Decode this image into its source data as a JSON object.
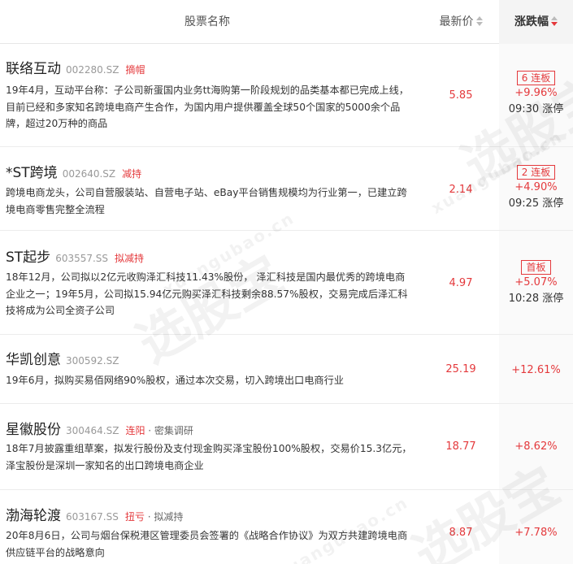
{
  "header": {
    "name_label": "股票名称",
    "price_label": "最新价",
    "change_label": "涨跌幅"
  },
  "rows": [
    {
      "name": "联络互动",
      "code": "002280.SZ",
      "tag": "摘帽",
      "tag2": "",
      "desc": "19年4月，互动平台称：子公司新蛋国内业务tt海购第一阶段规划的品类基本都已完成上线，目前已经和多家知名跨境电商产生合作，为国内用户提供覆盖全球50个国家的5000余个品牌，超过20万种的商品",
      "price": "5.85",
      "board": "6 连板",
      "change": "+9.96%",
      "limit_time": "09:30 涨停"
    },
    {
      "name": "*ST跨境",
      "code": "002640.SZ",
      "tag": "减持",
      "tag2": "",
      "desc": "跨境电商龙头，公司自营服装站、自营电子站、eBay平台销售规模均为行业第一，已建立跨境电商零售完整全流程",
      "price": "2.14",
      "board": "2 连板",
      "change": "+4.90%",
      "limit_time": "09:25 涨停"
    },
    {
      "name": "ST起步",
      "code": "603557.SS",
      "tag": "拟减持",
      "tag2": "",
      "desc": "18年12月，公司拟以2亿元收购泽汇科技11.43%股份， 泽汇科技是国内最优秀的跨境电商企业之一；19年5月，公司拟15.94亿元购买泽汇科技剩余88.57%股权，交易完成后泽汇科技将成为公司全资子公司",
      "price": "4.97",
      "board": "首板",
      "change": "+5.07%",
      "limit_time": "10:28 涨停"
    },
    {
      "name": "华凯创意",
      "code": "300592.SZ",
      "tag": "",
      "tag2": "",
      "desc": "19年6月，拟购买易佰网络90%股权，通过本次交易，切入跨境出口电商行业",
      "price": "25.19",
      "board": "",
      "change": "+12.61%",
      "limit_time": ""
    },
    {
      "name": "星徽股份",
      "code": "300464.SZ",
      "tag": "连阳",
      "tag2": " · 密集调研",
      "desc": "18年7月披露重组草案，拟发行股份及支付现金购买泽宝股份100%股权，交易价15.3亿元，泽宝股份是深圳一家知名的出口跨境电商企业",
      "price": "18.77",
      "board": "",
      "change": "+8.62%",
      "limit_time": ""
    },
    {
      "name": "渤海轮渡",
      "code": "603167.SS",
      "tag": "扭亏",
      "tag2": " · 拟减持",
      "desc": "20年8月6日，公司与烟台保税港区管理委员会签署的《战略合作协议》为双方共建跨境电商供应链平台的战略意向",
      "price": "8.87",
      "board": "",
      "change": "+7.78%",
      "limit_time": ""
    }
  ],
  "watermark": {
    "brand": "选股宝",
    "url": "xuangubao.cn"
  },
  "colors": {
    "up": "#e4393c",
    "header_active_bg": "#f4f4f4"
  }
}
